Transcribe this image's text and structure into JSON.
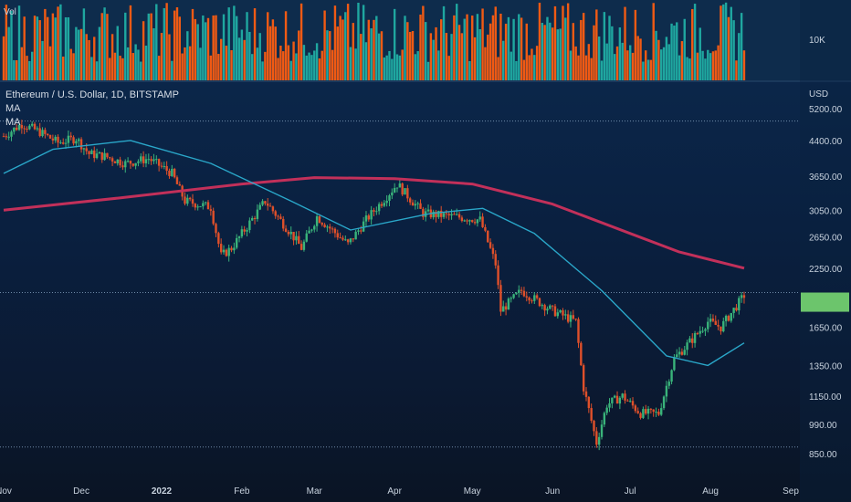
{
  "chart_data": {
    "type": "candlestick",
    "title": "Ethereum / U.S. Dollar, 1D, BITSTAMP",
    "indicators": [
      {
        "name": "MA",
        "period_hint": "short",
        "color": "#2aa7c9"
      },
      {
        "name": "MA",
        "period_hint": "long",
        "color": "#c2305a"
      }
    ],
    "volume_panel": {
      "label": "Vol",
      "tick": "10K",
      "colors": {
        "up": "#1fa7a0",
        "down": "#f05a14"
      }
    },
    "price_axis": {
      "unit": "USD",
      "scale": "log",
      "ticks": [
        "5200.00",
        "4400.00",
        "3650.00",
        "3050.00",
        "2650.00",
        "2250.00",
        "1650.00",
        "1350.00",
        "1150.00",
        "990.00",
        "850.00"
      ]
    },
    "x_axis": {
      "ticks": [
        "Nov",
        "Dec",
        "2022",
        "Feb",
        "Mar",
        "Apr",
        "May",
        "Jun",
        "Jul",
        "Aug",
        "Sep"
      ],
      "tick_dates": [
        "2021-11-01",
        "2021-12-01",
        "2022-01-01",
        "2022-02-01",
        "2022-03-01",
        "2022-04-01",
        "2022-05-01",
        "2022-06-01",
        "2022-07-01",
        "2022-08-01",
        "2022-09-01"
      ]
    },
    "reference_lines": [
      4870,
      1980,
      880
    ],
    "current_price_marker": {
      "color": "#6cc56c",
      "range": [
        1790,
        1980
      ]
    },
    "price_path": [
      {
        "date": "2021-11-01",
        "close": 4500
      },
      {
        "date": "2021-11-08",
        "close": 4800
      },
      {
        "date": "2021-11-15",
        "close": 4600
      },
      {
        "date": "2021-11-22",
        "close": 4350
      },
      {
        "date": "2021-11-29",
        "close": 4450
      },
      {
        "date": "2021-12-04",
        "close": 4100
      },
      {
        "date": "2021-12-10",
        "close": 4050
      },
      {
        "date": "2021-12-18",
        "close": 3900
      },
      {
        "date": "2021-12-27",
        "close": 4000
      },
      {
        "date": "2022-01-05",
        "close": 3700
      },
      {
        "date": "2022-01-10",
        "close": 3200
      },
      {
        "date": "2022-01-20",
        "close": 3100
      },
      {
        "date": "2022-01-24",
        "close": 2400
      },
      {
        "date": "2022-01-28",
        "close": 2500
      },
      {
        "date": "2022-02-10",
        "close": 3200
      },
      {
        "date": "2022-02-20",
        "close": 2700
      },
      {
        "date": "2022-02-24",
        "close": 2500
      },
      {
        "date": "2022-03-02",
        "close": 2950
      },
      {
        "date": "2022-03-14",
        "close": 2550
      },
      {
        "date": "2022-03-21",
        "close": 2900
      },
      {
        "date": "2022-04-02",
        "close": 3500
      },
      {
        "date": "2022-04-12",
        "close": 3000
      },
      {
        "date": "2022-04-24",
        "close": 2950
      },
      {
        "date": "2022-05-04",
        "close": 2900
      },
      {
        "date": "2022-05-10",
        "close": 2300
      },
      {
        "date": "2022-05-12",
        "close": 1800
      },
      {
        "date": "2022-05-20",
        "close": 2000
      },
      {
        "date": "2022-06-01",
        "close": 1800
      },
      {
        "date": "2022-06-10",
        "close": 1700
      },
      {
        "date": "2022-06-13",
        "close": 1200
      },
      {
        "date": "2022-06-18",
        "close": 900
      },
      {
        "date": "2022-06-22",
        "close": 1100
      },
      {
        "date": "2022-06-28",
        "close": 1150
      },
      {
        "date": "2022-07-05",
        "close": 1050
      },
      {
        "date": "2022-07-12",
        "close": 1050
      },
      {
        "date": "2022-07-18",
        "close": 1400
      },
      {
        "date": "2022-07-25",
        "close": 1550
      },
      {
        "date": "2022-07-31",
        "close": 1700
      },
      {
        "date": "2022-08-05",
        "close": 1650
      },
      {
        "date": "2022-08-14",
        "close": 1950
      }
    ],
    "ma_short": [
      {
        "date": "2021-11-01",
        "value": 3700
      },
      {
        "date": "2021-11-20",
        "value": 4200
      },
      {
        "date": "2021-12-20",
        "value": 4400
      },
      {
        "date": "2022-01-20",
        "value": 3900
      },
      {
        "date": "2022-02-20",
        "value": 3200
      },
      {
        "date": "2022-03-15",
        "value": 2750
      },
      {
        "date": "2022-04-15",
        "value": 3000
      },
      {
        "date": "2022-05-05",
        "value": 3080
      },
      {
        "date": "2022-05-25",
        "value": 2700
      },
      {
        "date": "2022-06-20",
        "value": 2000
      },
      {
        "date": "2022-07-15",
        "value": 1420
      },
      {
        "date": "2022-07-31",
        "value": 1350
      },
      {
        "date": "2022-08-14",
        "value": 1520
      }
    ],
    "ma_long": [
      {
        "date": "2021-11-01",
        "value": 3050
      },
      {
        "date": "2021-12-15",
        "value": 3250
      },
      {
        "date": "2022-02-01",
        "value": 3500
      },
      {
        "date": "2022-03-01",
        "value": 3620
      },
      {
        "date": "2022-04-01",
        "value": 3600
      },
      {
        "date": "2022-05-01",
        "value": 3500
      },
      {
        "date": "2022-06-01",
        "value": 3150
      },
      {
        "date": "2022-07-01",
        "value": 2700
      },
      {
        "date": "2022-07-20",
        "value": 2450
      },
      {
        "date": "2022-08-14",
        "value": 2250
      }
    ]
  }
}
